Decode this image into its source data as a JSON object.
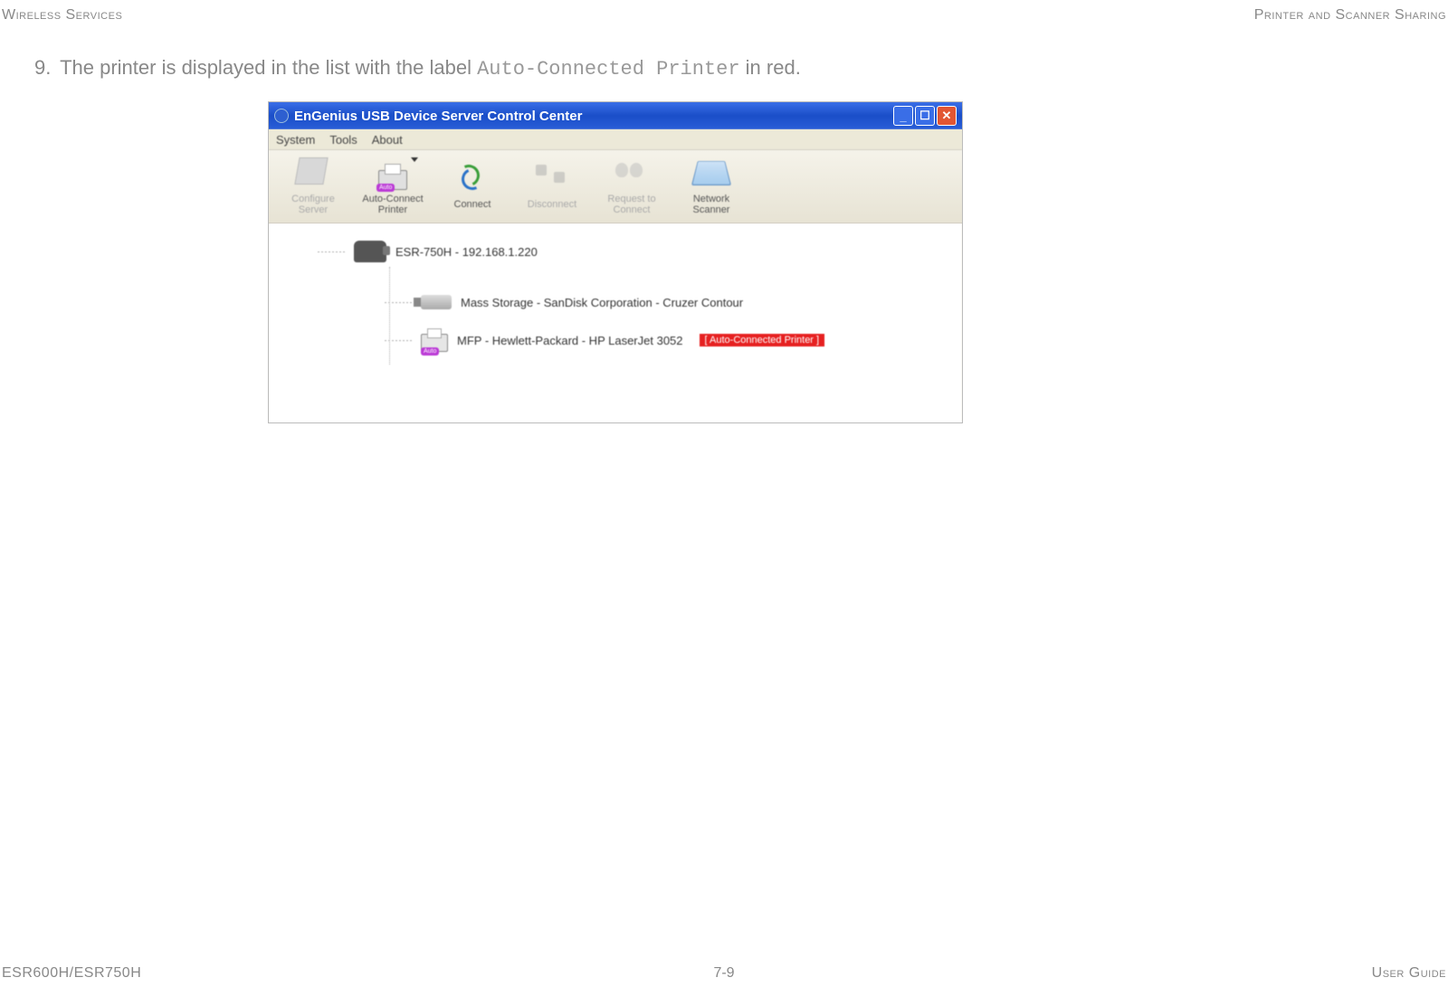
{
  "header": {
    "left": "Wireless Services",
    "right": "Printer and Scanner Sharing"
  },
  "footer": {
    "left": "ESR600H/ESR750H",
    "center": "7-9",
    "right": "User Guide"
  },
  "step": {
    "number": "9.",
    "text_before": "The printer is displayed in the list with the label ",
    "mono": "Auto-Connected Printer",
    "text_after": " in red."
  },
  "window": {
    "title": "EnGenius USB Device Server Control Center",
    "menus": [
      "System",
      "Tools",
      "About"
    ],
    "toolbar": {
      "configure": "Configure Server",
      "auto_printer": "Auto-Connect Printer",
      "connect": "Connect",
      "disconnect": "Disconnect",
      "request": "Request to Connect",
      "scanner": "Network Scanner",
      "auto_badge": "Auto"
    },
    "tree": {
      "root": "ESR-750H - 192.168.1.220",
      "storage": "Mass Storage - SanDisk Corporation - Cruzer Contour",
      "mfp": "MFP - Hewlett-Packard - HP LaserJet 3052",
      "red_label": "[ Auto-Connected Printer ]",
      "auto_badge": "Auto"
    }
  }
}
